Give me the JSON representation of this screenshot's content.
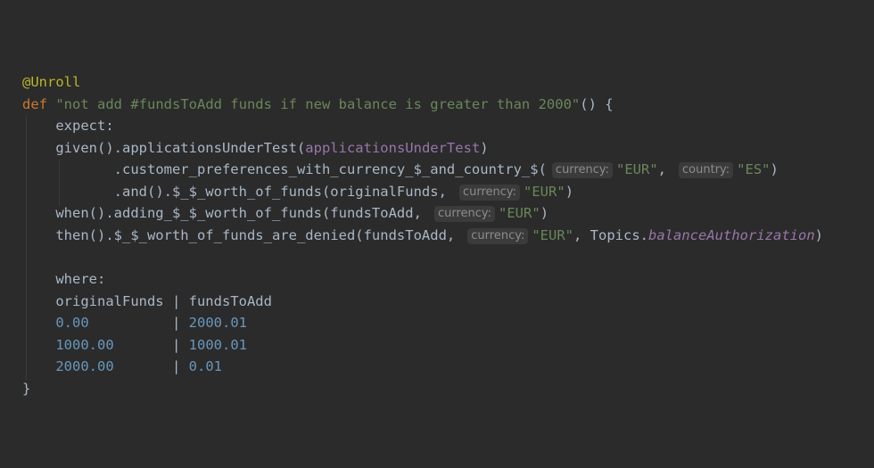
{
  "colors": {
    "background": "#2b2b2b",
    "annotation": "#bbb529",
    "keyword": "#cc7832",
    "string": "#6a8759",
    "field": "#9876aa",
    "number": "#6897bb",
    "plain": "#a9b7c6",
    "hint_bg": "#3b3b3b",
    "hint_text": "#8c8c8c"
  },
  "code": {
    "l1": {
      "annotation": "@Unroll"
    },
    "l2": {
      "keyword": "def",
      "space": " ",
      "string": "\"not add #fundsToAdd funds if new balance is greater than 2000\"",
      "rest": "() {"
    },
    "l3": {
      "indent": "    ",
      "text": "expect:"
    },
    "l4": {
      "indent": "    ",
      "prefix": "given().applicationsUnderTest(",
      "field": "applicationsUnderTest",
      "suffix": ")"
    },
    "l5": {
      "indent": "           ",
      "prefix": ".customer_preferences_with_currency_$_and_country_$(",
      "hint1": "currency:",
      "value1": "\"EUR\"",
      "sep": ",",
      "hint2": "country:",
      "value2": "\"ES\"",
      "suffix": ")"
    },
    "l6": {
      "indent": "           ",
      "prefix": ".and().$_$_worth_of_funds(originalFunds,",
      "hint": "currency:",
      "value": "\"EUR\"",
      "suffix": ")"
    },
    "l7": {
      "indent": "    ",
      "prefix": "when().adding_$_$_worth_of_funds(fundsToAdd,",
      "hint": "currency:",
      "value": "\"EUR\"",
      "suffix": ")"
    },
    "l8": {
      "indent": "    ",
      "prefix": "then().$_$_worth_of_funds_are_denied(fundsToAdd,",
      "hint": "currency:",
      "value": "\"EUR\"",
      "mid": ", Topics.",
      "field": "balanceAuthorization",
      "suffix": ")"
    },
    "l10": {
      "indent": "    ",
      "text": "where:"
    },
    "l11": {
      "indent": "    ",
      "text": "originalFunds | fundsToAdd"
    },
    "rows": [
      {
        "indent": "    ",
        "a": "0.00",
        "pad": "          ",
        "pipe": "| ",
        "b": "2000.01"
      },
      {
        "indent": "    ",
        "a": "1000.00",
        "pad": "       ",
        "pipe": "| ",
        "b": "1000.01"
      },
      {
        "indent": "    ",
        "a": "2000.00",
        "pad": "       ",
        "pipe": "| ",
        "b": "0.01"
      }
    ],
    "l15": {
      "text": "}"
    }
  }
}
